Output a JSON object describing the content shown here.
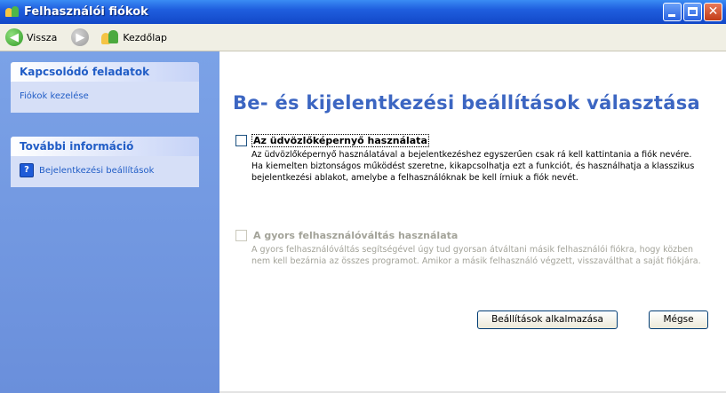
{
  "window": {
    "title": "Felhasználói fiókok"
  },
  "toolbar": {
    "back_label": "Vissza",
    "home_label": "Kezdőlap"
  },
  "sidebar": {
    "related_tasks": {
      "title": "Kapcsolódó feladatok",
      "items": [
        "Fiókok kezelése"
      ]
    },
    "more_info": {
      "title": "További információ",
      "items": [
        "Bejelentkezési beállítások"
      ]
    }
  },
  "main": {
    "heading": "Be- és kijelentkezési beállítások választása",
    "options": [
      {
        "label": "Az üdvözlőképernyő használata",
        "description": "Az üdvözlőképernyő használatával a bejelentkezéshez egyszerűen csak rá kell kattintania a fiók nevére. Ha kiemelten biztonságos működést szeretne, kikapcsolhatja ezt a funkciót, és használhatja a klasszikus bejelentkezési ablakot, amelybe a felhasználóknak be kell írniuk a fiók nevét.",
        "checked": false,
        "enabled": true
      },
      {
        "label": "A gyors felhasználóváltás használata",
        "description": "A gyors felhasználóváltás segítségével úgy tud gyorsan átváltani másik felhasználói fiókra, hogy közben nem kell bezárnia az összes programot. Amikor a másik felhasználó végzett, visszaválthat a saját fiókjára.",
        "checked": false,
        "enabled": false
      }
    ],
    "buttons": {
      "apply": "Beállítások alkalmazása",
      "cancel": "Mégse"
    }
  },
  "colors": {
    "titlebar": "#1f5ede",
    "sidebar_bg": "#7ba2e7",
    "heading": "#3c66c2",
    "link": "#215dc6"
  }
}
